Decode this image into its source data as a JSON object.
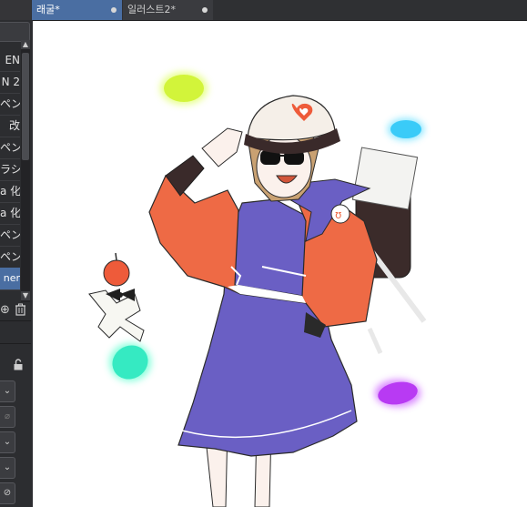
{
  "tabs": [
    {
      "label": "래굴*"
    },
    {
      "label": "일러스트2*"
    }
  ],
  "sidebar": {
    "items": [
      {
        "label": "EN"
      },
      {
        "label": "N 2"
      },
      {
        "label": "ペン"
      },
      {
        "label": "改"
      },
      {
        "label": "ペン"
      },
      {
        "label": "ラシ"
      },
      {
        "label": "a 化"
      },
      {
        "label": "a 化"
      },
      {
        "label": "ペン"
      },
      {
        "label": "ペン"
      },
      {
        "label": "ner"
      }
    ]
  },
  "colors": {
    "active_tab": "#4a6ea2",
    "jacket": "#ee6a45",
    "dress": "#6a5fc4",
    "glow_yellow": "#d7ff3a",
    "glow_cyan": "#3ad6ff",
    "glow_teal": "#3affc4",
    "glow_purple": "#c03aff"
  },
  "icons": {
    "scroll_up": "▲",
    "scroll_down": "▼",
    "add": "⊕",
    "delete": "🗑",
    "lock": "🔓",
    "chevron": "⌄"
  }
}
